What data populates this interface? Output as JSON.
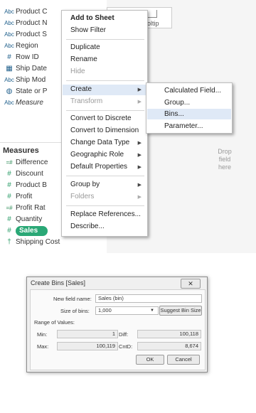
{
  "data_pane": {
    "dimensions": [
      {
        "type": "Abc",
        "label": "Product C"
      },
      {
        "type": "Abc",
        "label": "Product N"
      },
      {
        "type": "Abc",
        "label": "Product S"
      },
      {
        "type": "Abc",
        "label": "Region"
      },
      {
        "type": "#",
        "label": "Row ID"
      },
      {
        "type": "▦",
        "label": "Ship Date"
      },
      {
        "type": "Abc",
        "label": "Ship Mod"
      },
      {
        "type": "◍",
        "label": "State or P"
      },
      {
        "type": "Abc",
        "label": "Measure"
      }
    ],
    "measures_header": "Measures",
    "measures": [
      {
        "type": "=#",
        "label": "Difference"
      },
      {
        "type": "#",
        "label": "Discount"
      },
      {
        "type": "#",
        "label": "Product B"
      },
      {
        "type": "#",
        "label": "Profit"
      },
      {
        "type": "=#",
        "label": "Profit Rat"
      },
      {
        "type": "#",
        "label": "Quantity"
      },
      {
        "type": "#",
        "label": "Sales"
      },
      {
        "type": "†",
        "label": "Shipping Cost"
      }
    ]
  },
  "canvas": {
    "shelf_text": "oltip",
    "drop_hint": [
      "Drop",
      "field",
      "here"
    ]
  },
  "context_menu": {
    "items": [
      {
        "label": "Add to Sheet"
      },
      {
        "label": "Show Filter"
      },
      {
        "label": "Duplicate"
      },
      {
        "label": "Rename"
      },
      {
        "label": "Hide"
      },
      {
        "label": "Create"
      },
      {
        "label": "Transform"
      },
      {
        "label": "Convert to Discrete"
      },
      {
        "label": "Convert to Dimension"
      },
      {
        "label": "Change Data Type"
      },
      {
        "label": "Geographic Role"
      },
      {
        "label": "Default Properties"
      },
      {
        "label": "Group by"
      },
      {
        "label": "Folders"
      },
      {
        "label": "Replace References..."
      },
      {
        "label": "Describe..."
      }
    ],
    "submenu_arrow": "▶"
  },
  "create_submenu": {
    "items": [
      {
        "label": "Calculated Field..."
      },
      {
        "label": "Group..."
      },
      {
        "label": "Bins..."
      },
      {
        "label": "Parameter..."
      }
    ]
  },
  "dialog": {
    "title": "Create Bins [Sales]",
    "close": "✕",
    "new_field_label": "New field name:",
    "new_field_value": "Sales (bin)",
    "size_label": "Size of bins:",
    "size_value": "1,000",
    "suggest_button": "Suggest Bin Size",
    "range_header": "Range of Values:",
    "min_label": "Min:",
    "min_value": "1",
    "diff_label": "Diff:",
    "diff_value": "100,118",
    "max_label": "Max:",
    "max_value": "100,119",
    "cntd_label": "CntD:",
    "cntd_value": "8,674",
    "ok_button": "OK",
    "cancel_button": "Cancel"
  }
}
